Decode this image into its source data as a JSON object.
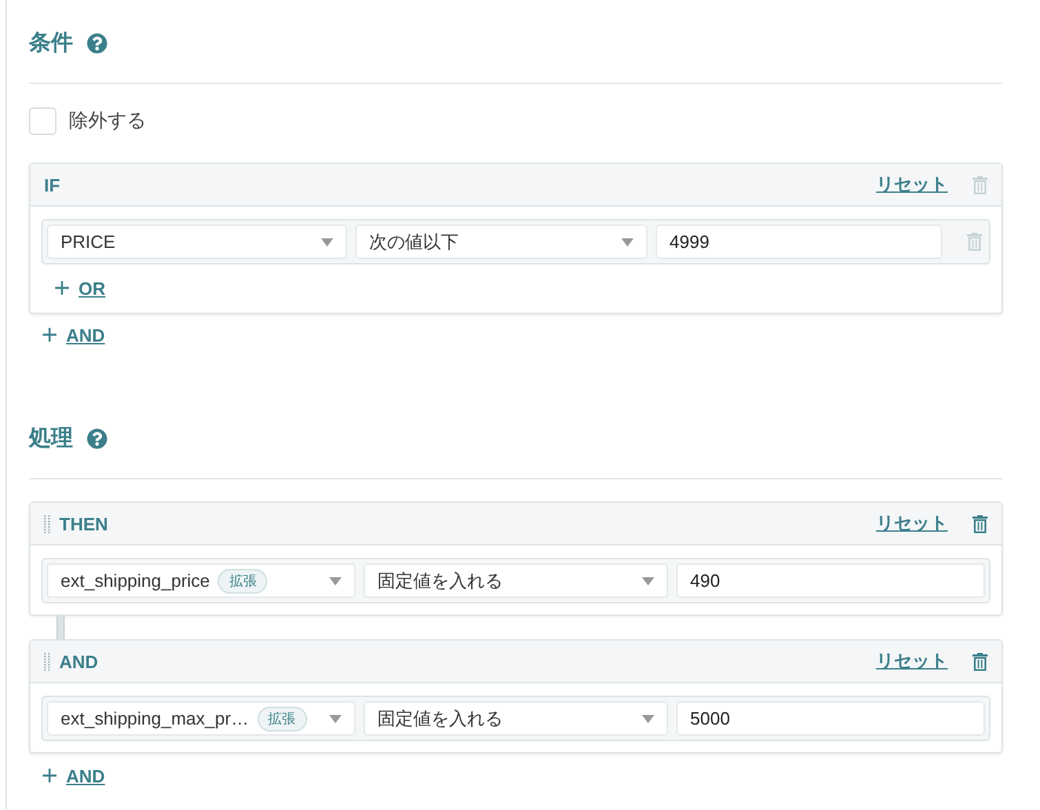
{
  "conditions": {
    "title": "条件",
    "exclude": {
      "label": "除外する",
      "checked": false
    },
    "groups": [
      {
        "label": "IF",
        "reset": "リセット",
        "delete_disabled": true,
        "or": "OR",
        "rows": [
          {
            "field": "PRICE",
            "operator": "次の値以下",
            "value": "4999",
            "delete_disabled": true
          }
        ]
      }
    ],
    "and": "AND"
  },
  "actions": {
    "title": "処理",
    "blocks": [
      {
        "label": "THEN",
        "reset": "リセット",
        "delete_disabled": false,
        "field": "ext_shipping_price",
        "badge": "拡張",
        "operator": "固定値を入れる",
        "value": "490"
      },
      {
        "label": "AND",
        "reset": "リセット",
        "delete_disabled": false,
        "field": "ext_shipping_max_pr…",
        "badge": "拡張",
        "operator": "固定値を入れる",
        "value": "5000"
      }
    ],
    "and": "AND"
  }
}
